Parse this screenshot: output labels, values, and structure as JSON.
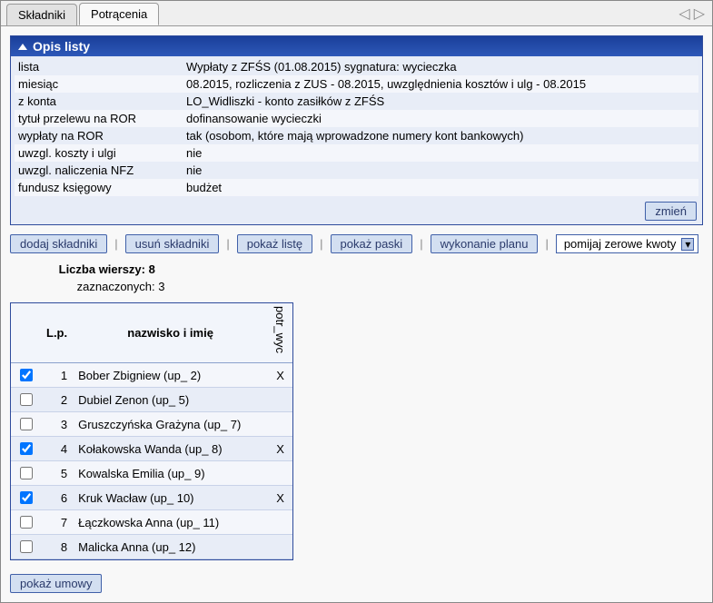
{
  "tabs": {
    "items": [
      {
        "label": "Składniki",
        "active": false
      },
      {
        "label": "Potrącenia",
        "active": true
      }
    ]
  },
  "panel": {
    "title": "Opis listy",
    "rows": [
      {
        "label": "lista",
        "value": "Wypłaty z ZFŚS (01.08.2015) sygnatura: wycieczka"
      },
      {
        "label": "miesiąc",
        "value": "08.2015, rozliczenia z ZUS - 08.2015, uwzględnienia kosztów i ulg - 08.2015"
      },
      {
        "label": "z konta",
        "value": "LO_Widliszki - konto zasiłków z ZFŚS"
      },
      {
        "label": "tytuł przelewu na ROR",
        "value": "dofinansowanie wycieczki"
      },
      {
        "label": "wypłaty na ROR",
        "value": "tak (osobom, które mają wprowadzone numery kont bankowych)"
      },
      {
        "label": "uwzgl. koszty i ulgi",
        "value": "nie"
      },
      {
        "label": "uwzgl. naliczenia NFZ",
        "value": "nie"
      },
      {
        "label": "fundusz księgowy",
        "value": "budżet"
      }
    ],
    "change_btn": "zmień"
  },
  "toolbar": {
    "add": "dodaj składniki",
    "remove": "usuń składniki",
    "show_list": "pokaż listę",
    "show_slips": "pokaż paski",
    "plan": "wykonanie planu",
    "filter_selected": "pomijaj zerowe kwoty"
  },
  "summary": {
    "rows_label": "Liczba wierszy:",
    "rows_value": "8",
    "selected_label": "zaznaczonych:",
    "selected_value": "3"
  },
  "table": {
    "headers": {
      "lp": "L.p.",
      "name": "nazwisko i imię",
      "col1": "potr_wyc"
    },
    "rows": [
      {
        "checked": true,
        "lp": "1",
        "name": "Bober Zbigniew (up_ 2)",
        "mark": "X"
      },
      {
        "checked": false,
        "lp": "2",
        "name": "Dubiel Zenon (up_ 5)",
        "mark": ""
      },
      {
        "checked": false,
        "lp": "3",
        "name": "Gruszczyńska Grażyna (up_ 7)",
        "mark": ""
      },
      {
        "checked": true,
        "lp": "4",
        "name": "Kołakowska Wanda (up_ 8)",
        "mark": "X"
      },
      {
        "checked": false,
        "lp": "5",
        "name": "Kowalska Emilia (up_ 9)",
        "mark": ""
      },
      {
        "checked": true,
        "lp": "6",
        "name": "Kruk Wacław (up_ 10)",
        "mark": "X"
      },
      {
        "checked": false,
        "lp": "7",
        "name": "Łączkowska Anna (up_ 11)",
        "mark": ""
      },
      {
        "checked": false,
        "lp": "8",
        "name": "Malicka Anna (up_ 12)",
        "mark": ""
      }
    ]
  },
  "footer": {
    "show_contracts": "pokaż umowy"
  }
}
